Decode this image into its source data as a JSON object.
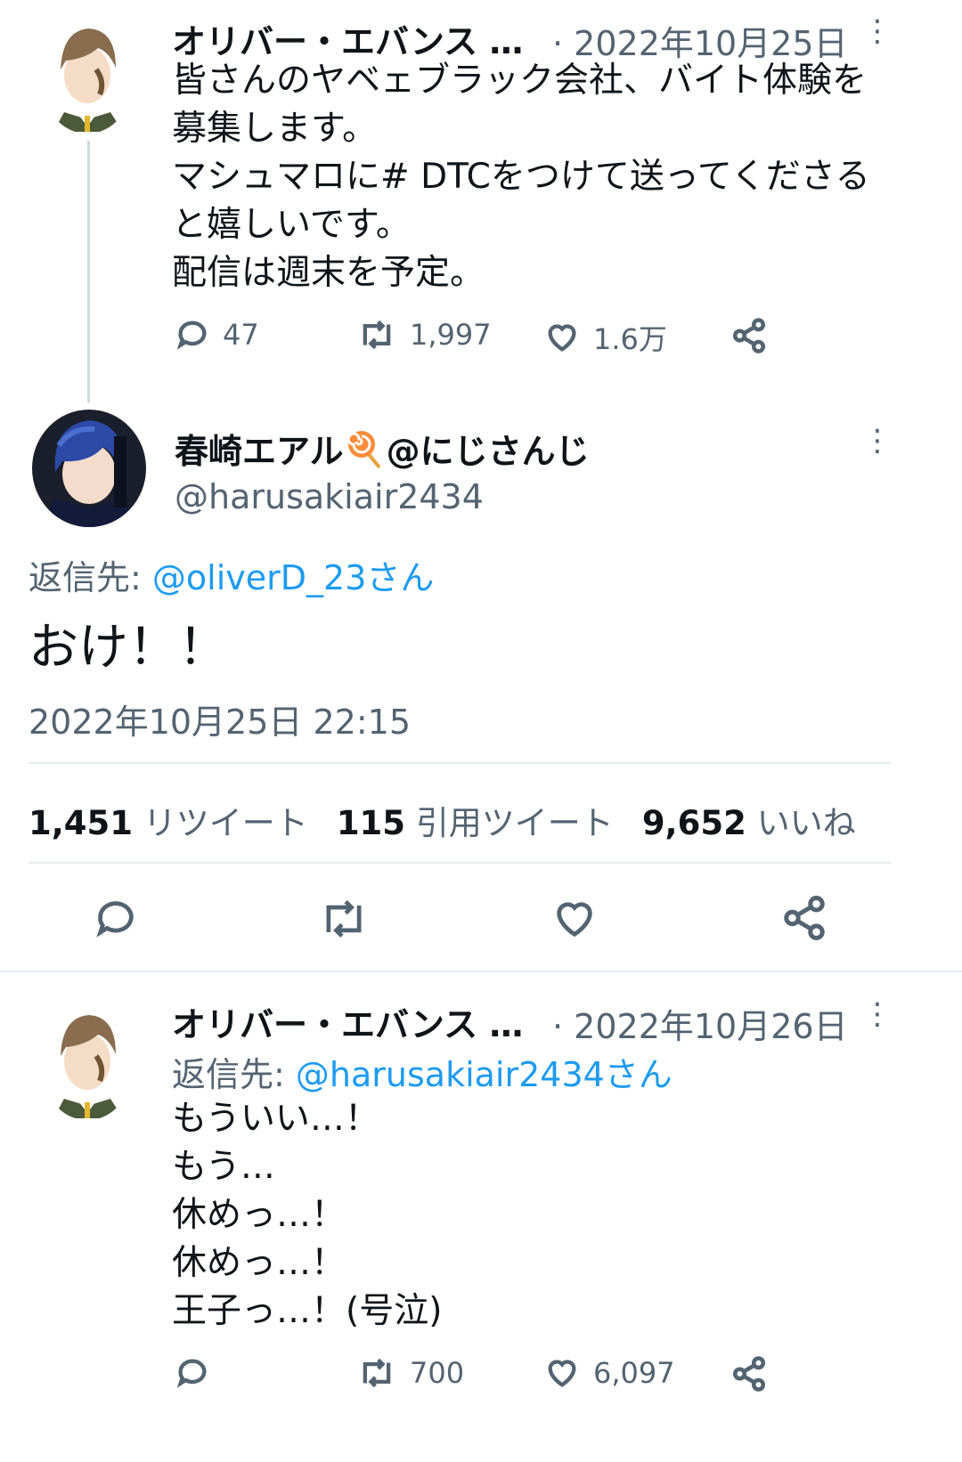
{
  "tweet1": {
    "display_name": "オリバー・エバンス …",
    "date": "· 2022年10月25日",
    "text": "皆さんのヤベェブラック会社、バイト体験を\n募集します。\nマシュマロに# DTCをつけて送ってくださる\nと嬉しいです。\n配信は週末を予定。",
    "actions": {
      "reply": "47",
      "retweet": "1,997",
      "like": "1.6万"
    }
  },
  "main_tweet": {
    "display_name": "春崎エアル",
    "name_suffix": "@にじさんじ",
    "handle": "@harusakiair2434",
    "reply_to_label": "返信先:",
    "reply_to_user": "@oliverD_23さん",
    "text": "おけ！！",
    "timestamp": "2022年10月25日 22:15",
    "stats": {
      "retweets_num": "1,451",
      "retweets_label": "リツイート",
      "quotes_num": "115",
      "quotes_label": "引用ツイート",
      "likes_num": "9,652",
      "likes_label": "いいね"
    }
  },
  "tweet3": {
    "display_name": "オリバー・エバンス …",
    "date": "· 2022年10月26日",
    "reply_to_label": "返信先:",
    "reply_to_user": "@harusakiair2434さん",
    "text": "もういい…！\nもう…\n休めっ…！\n休めっ…！\n王子っ…！(号泣)",
    "actions": {
      "retweet": "700",
      "like": "6,097"
    }
  },
  "icons": [
    "more-icon",
    "reply-icon",
    "retweet-icon",
    "like-icon",
    "share-icon",
    "lollipop-icon"
  ],
  "colors": {
    "link": "#1d9bf0",
    "secondary": "#536471",
    "divider": "#e6ecf0"
  }
}
